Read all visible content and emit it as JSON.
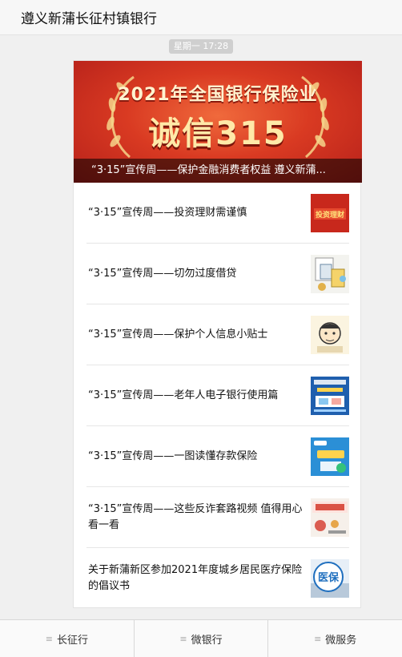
{
  "header": {
    "title": "遵义新蒲长征村镇银行"
  },
  "message_time": "星期一 17:28",
  "hero": {
    "image_year_text": "2021年全国银行保险业",
    "image_main_text": "诚信315",
    "caption": "“3·15”宣传周——保护金融消费者权益 遵义新蒲..."
  },
  "articles": [
    {
      "title": "“3·15”宣传周——投资理财需谨慎",
      "thumb_icon": "investment-caution-thumb",
      "thumb_text": "投资理财"
    },
    {
      "title": "“3·15”宣传周——切勿过度借贷",
      "thumb_icon": "excessive-loan-thumb"
    },
    {
      "title": "“3·15”宣传周——保护个人信息小贴士",
      "thumb_icon": "personal-info-thumb"
    },
    {
      "title": "“3·15”宣传周——老年人电子银行使用篇",
      "thumb_icon": "elderly-ebanking-thumb"
    },
    {
      "title": "“3·15”宣传周——一图读懂存款保险",
      "thumb_icon": "deposit-insurance-thumb"
    },
    {
      "title": "“3·15”宣传周——这些反诈套路视频 值得用心看一看",
      "thumb_icon": "anti-fraud-video-thumb"
    },
    {
      "title": "关于新蒲新区参加2021年度城乡居民医疗保险的倡议书",
      "thumb_icon": "medical-insurance-thumb",
      "thumb_text": "医保"
    }
  ],
  "tabbar": {
    "items": [
      {
        "label": "长征行"
      },
      {
        "label": "微银行"
      },
      {
        "label": "微服务"
      }
    ],
    "menu_glyph": "≡"
  },
  "colors": {
    "hero_red": "#d93a22",
    "hero_gold": "#ffe9a8",
    "thumb_blue": "#1f5fae"
  }
}
